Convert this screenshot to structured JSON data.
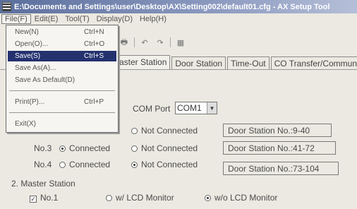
{
  "window": {
    "title": "E:\\Documents and Settings\\user\\Desktop\\AX\\Setting002\\default01.cfg - AX Setup Tool"
  },
  "menubar": {
    "items": [
      "File(F)",
      "Edit(E)",
      "Tool(T)",
      "Display(D)",
      "Help(H)"
    ]
  },
  "file_menu": {
    "items": [
      {
        "label": "New(N)",
        "shortcut": "Ctrl+N"
      },
      {
        "label": "Open(O)...",
        "shortcut": "Ctrl+O"
      },
      {
        "label": "Save(S)",
        "shortcut": "Ctrl+S"
      },
      {
        "label": "Save As(A)...",
        "shortcut": ""
      },
      {
        "label": "Save As Default(D)",
        "shortcut": ""
      },
      {
        "label": "Print(P)...",
        "shortcut": "Ctrl+P"
      },
      {
        "label": "Exit(X)",
        "shortcut": ""
      }
    ],
    "highlighted": "Save(S)"
  },
  "tabs": [
    "Master Station",
    "Door Station",
    "Time-Out",
    "CO Transfer/Commun"
  ],
  "com_port": {
    "label": "COM Port",
    "value": "COM1"
  },
  "stations": {
    "row2": {
      "not_connected": "Not Connected",
      "range": "Door Station No.:9-40"
    },
    "row3": {
      "name": "No.3",
      "connected": "Connected",
      "not_connected": "Not Connected",
      "range": "Door Station No.:41-72"
    },
    "row4": {
      "name": "No.4",
      "connected": "Connected",
      "not_connected": "Not Connected",
      "range": "Door Station No.:73-104"
    }
  },
  "master_station": {
    "heading": "2. Master Station",
    "checkbox_label": "No.1",
    "option_lcd": "w/ LCD Monitor",
    "option_no_lcd": "w/o LCD Monitor"
  },
  "toolbar": {
    "icons": [
      "print-icon",
      "undo-icon",
      "redo-icon",
      "settings-icon"
    ]
  }
}
